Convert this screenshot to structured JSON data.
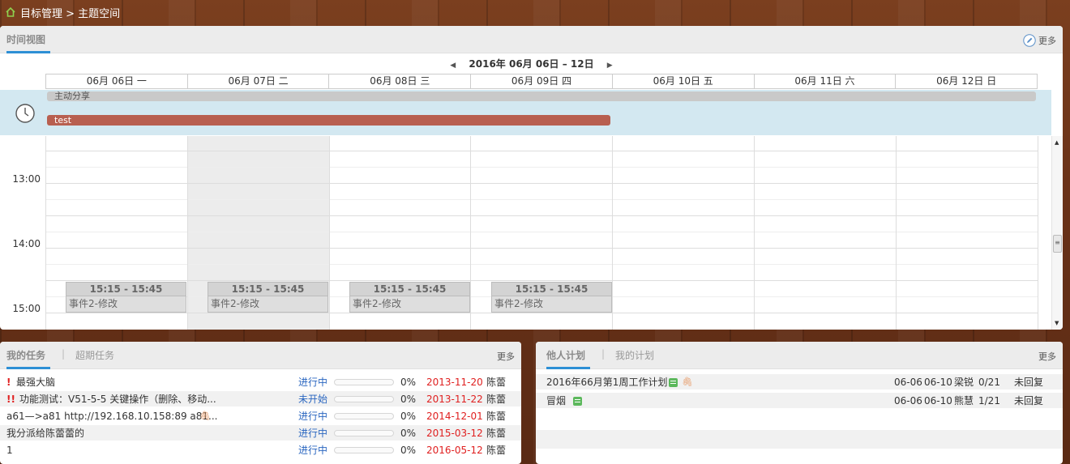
{
  "breadcrumb": {
    "text": "目标管理 > 主题空间"
  },
  "calendar": {
    "tab_label": "时间视图",
    "more_label": "更多",
    "range_label": "2016年 06月 06日 – 12日",
    "days": [
      "06月 06日 一",
      "06月 07日 二",
      "06月 08日 三",
      "06月 09日 四",
      "06月 10日 五",
      "06月 11日 六",
      "06月 12日 日"
    ],
    "allday_events": [
      {
        "label": "主动分享"
      },
      {
        "label": "test"
      }
    ],
    "time_labels": [
      "13:00",
      "14:00",
      "15:00"
    ],
    "events": [
      {
        "time": "15:15 - 15:45",
        "title": "事件2-修改"
      },
      {
        "time": "15:15 - 15:45",
        "title": "事件2-修改"
      },
      {
        "time": "15:15 - 15:45",
        "title": "事件2-修改"
      },
      {
        "time": "15:15 - 15:45",
        "title": "事件2-修改"
      }
    ],
    "colors": {
      "allday_bg": "#d3e8f1",
      "test_bar": "#b85f50",
      "accent": "#2d8fd5"
    }
  },
  "tasks": {
    "tab_active": "我的任务",
    "tab_other": "超期任务",
    "more_label": "更多",
    "rows": [
      {
        "prio": "!",
        "name": "最强大脑",
        "status": "进行中",
        "progress": "0%",
        "due": "2013-11-20",
        "owner": "陈蕾"
      },
      {
        "prio": "!!",
        "name": "功能测试：V51-5-5 关键操作（删除、移动...",
        "status": "未开始",
        "progress": "0%",
        "due": "2013-11-22",
        "owner": "陈蕾"
      },
      {
        "prio": "",
        "name": "a61—>a81 http://192.168.10.158:89 a81...",
        "status": "进行中",
        "progress": "0%",
        "due": "2014-12-01",
        "owner": "陈蕾"
      },
      {
        "prio": "",
        "name": "我分派给陈蕾蕾的",
        "status": "进行中",
        "progress": "0%",
        "due": "2015-03-12",
        "owner": "陈蕾"
      },
      {
        "prio": "",
        "name": "1",
        "status": "进行中",
        "progress": "0%",
        "due": "2016-05-12",
        "owner": "陈蕾"
      }
    ]
  },
  "plans": {
    "tab_active": "他人计划",
    "tab_other": "我的计划",
    "more_label": "更多",
    "rows": [
      {
        "name": "2016年66月第1周工作计划",
        "start": "06-06",
        "end": "06-10",
        "owner": "梁锐",
        "count": "0/21",
        "reply": "未回复"
      },
      {
        "name": "冒烟",
        "start": "06-06",
        "end": "06-10",
        "owner": "熊慧",
        "count": "1/21",
        "reply": "未回复"
      }
    ]
  }
}
